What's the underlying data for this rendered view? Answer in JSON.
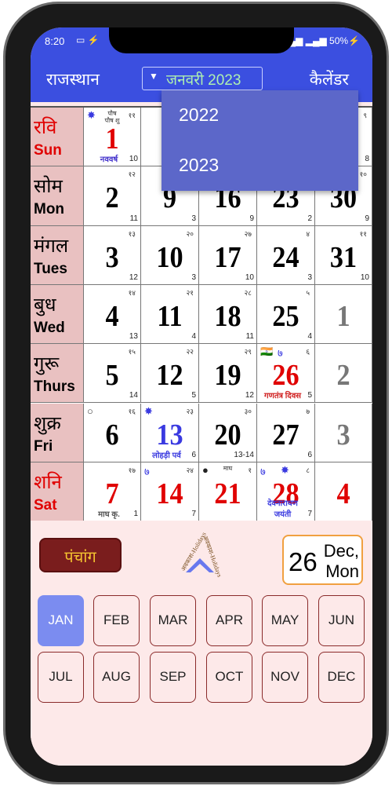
{
  "status": {
    "time": "8:20",
    "icons": "▭ ⚡",
    "battery": "▂▄▆ ▂▄▆ 50%⚡"
  },
  "header": {
    "region": "राजस्थान",
    "month_year": "जनवरी 2023",
    "title": "कैलेंडर"
  },
  "dropdown": {
    "options": [
      "2022",
      "2023"
    ]
  },
  "days": [
    {
      "hi": "रवि",
      "en": "Sun",
      "color": "#e00000",
      "cells": [
        {
          "date": "1",
          "color": "#e00000",
          "tithi": "११",
          "bottom": "10",
          "note": "नववर्ष",
          "note_color": "#4433cc",
          "top": "पौष\nपौष शु",
          "icon": "✸"
        },
        {},
        {},
        {},
        {
          "tithi": "९",
          "bottom": "8"
        }
      ]
    },
    {
      "hi": "सोम",
      "en": "Mon",
      "color": "#000",
      "cells": [
        {
          "date": "2",
          "tithi": "१२",
          "bottom": "11"
        },
        {
          "date": "9",
          "bottom": "3"
        },
        {
          "date": "16",
          "bottom": "9"
        },
        {
          "date": "23",
          "bottom": "2"
        },
        {
          "date": "30",
          "tithi": "१०",
          "bottom": "9"
        }
      ]
    },
    {
      "hi": "मंगल",
      "en": "Tues",
      "color": "#000",
      "cells": [
        {
          "date": "3",
          "tithi": "१३",
          "bottom": "12"
        },
        {
          "date": "10",
          "tithi": "२०",
          "bottom": "3"
        },
        {
          "date": "17",
          "tithi": "२७",
          "bottom": "10"
        },
        {
          "date": "24",
          "tithi": "४",
          "bottom": "3"
        },
        {
          "date": "31",
          "tithi": "११",
          "bottom": "10"
        }
      ]
    },
    {
      "hi": "बुध",
      "en": "Wed",
      "color": "#000",
      "cells": [
        {
          "date": "4",
          "tithi": "१४",
          "bottom": "13"
        },
        {
          "date": "11",
          "tithi": "२१",
          "bottom": "4"
        },
        {
          "date": "18",
          "tithi": "२८",
          "bottom": "11"
        },
        {
          "date": "25",
          "tithi": "५",
          "bottom": "4"
        },
        {
          "date": "1",
          "color": "#777"
        }
      ]
    },
    {
      "hi": "गुरू",
      "en": "Thurs",
      "color": "#000",
      "cells": [
        {
          "date": "5",
          "tithi": "१५",
          "bottom": "14"
        },
        {
          "date": "12",
          "tithi": "२२",
          "bottom": "5"
        },
        {
          "date": "19",
          "tithi": "२९",
          "bottom": "12"
        },
        {
          "date": "26",
          "color": "#e00000",
          "tithi": "६",
          "bottom": "5",
          "note": "गणतंत्र दिवस",
          "note_color": "#d02020",
          "icon": "🇮🇳",
          "icon2": "७"
        },
        {
          "date": "2",
          "color": "#777"
        }
      ]
    },
    {
      "hi": "शुक्र",
      "en": "Fri",
      "color": "#000",
      "cells": [
        {
          "date": "6",
          "tithi": "१६",
          "icon": "○"
        },
        {
          "date": "13",
          "color": "#3a3ae0",
          "tithi": "२३",
          "bottom": "6",
          "note": "लोहड़ी पर्व",
          "note_color": "#3a3ae0",
          "icon": "✸"
        },
        {
          "date": "20",
          "tithi": "३०",
          "bottom": "13-14"
        },
        {
          "date": "27",
          "tithi": "७",
          "bottom": "6"
        },
        {
          "date": "3",
          "color": "#777"
        }
      ]
    },
    {
      "hi": "शनि",
      "en": "Sat",
      "color": "#e00000",
      "cells": [
        {
          "date": "7",
          "color": "#e00000",
          "tithi": "१७",
          "bottom": "1",
          "note": "माघ कृ.",
          "note_color": "#555"
        },
        {
          "date": "14",
          "color": "#e00000",
          "tithi": "२४",
          "bottom": "7",
          "icon": "७"
        },
        {
          "date": "21",
          "color": "#e00000",
          "tithi": "१",
          "top": "माघ",
          "icon": "●"
        },
        {
          "date": "28",
          "color": "#e00000",
          "tithi": "८",
          "bottom": "7",
          "note": "देवनारायण जयंती",
          "note_color": "#3a3ae0",
          "icon": "७",
          "icon2": "✸"
        },
        {
          "date": "4",
          "color": "#e00000"
        }
      ]
    }
  ],
  "bottom": {
    "panchang": "पंचांग",
    "holidays_top": "अवकाश-Holidays",
    "holidays_bottom": "अवकाश-Holidays",
    "today_day": "26",
    "today_month": "Dec,",
    "today_weekday": "Mon"
  },
  "months": [
    "JAN",
    "FEB",
    "MAR",
    "APR",
    "MAY",
    "JUN",
    "JUL",
    "AUG",
    "SEP",
    "OCT",
    "NOV",
    "DEC"
  ],
  "selected_month": "JAN",
  "colors": {
    "header": "#3b4fe0",
    "dropdown": "#5c67c9",
    "day_label_bg": "#e9c1c1",
    "selected_month": "#7b8cf0"
  }
}
